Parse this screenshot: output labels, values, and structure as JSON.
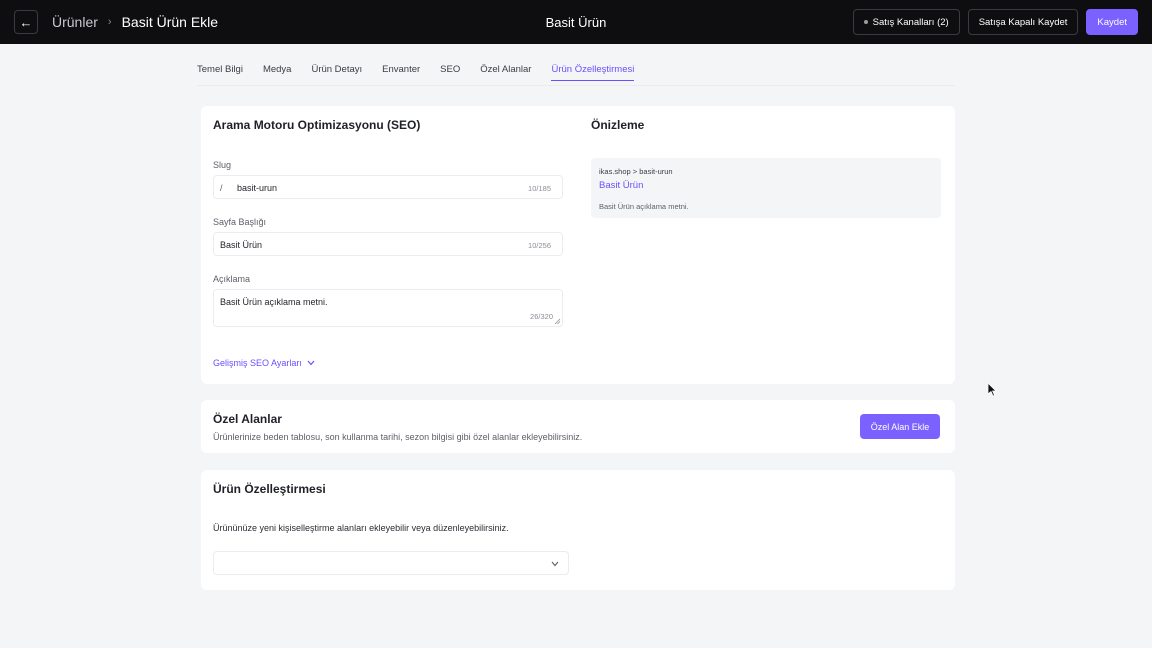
{
  "header": {
    "back_icon": "arrow-left-icon",
    "breadcrumb_parent": "Ürünler",
    "breadcrumb_separator": "›",
    "breadcrumb_current": "Basit Ürün Ekle",
    "center_title": "Basit Ürün",
    "sales_channels_label": "Satış Kanalları (2)",
    "save_closed_label": "Satışa Kapalı Kaydet",
    "save_label": "Kaydet",
    "primary_color": "#7b61ff"
  },
  "tabs": [
    {
      "label": "Temel Bilgi"
    },
    {
      "label": "Medya"
    },
    {
      "label": "Ürün Detayı"
    },
    {
      "label": "Envanter"
    },
    {
      "label": "SEO"
    },
    {
      "label": "Özel Alanlar"
    },
    {
      "label": "Ürün Özelleştirmesi",
      "active": true
    }
  ],
  "seo": {
    "title": "Arama Motoru Optimizasyonu (SEO)",
    "slug_label": "Slug",
    "slug_prefix": "/",
    "slug_value": "basit-urun",
    "slug_count": "10/185",
    "page_title_label": "Sayfa Başlığı",
    "page_title_value": "Basit Ürün",
    "page_title_count": "10/256",
    "description_label": "Açıklama",
    "description_value": "Basit Ürün açıklama metni.",
    "description_count": "26/320",
    "advanced_link": "Gelişmiş SEO Ayarları"
  },
  "preview": {
    "title": "Önizleme",
    "url": "ikas.shop > basit-urun",
    "page_title": "Basit Ürün",
    "description": "Basit Ürün açıklama metni."
  },
  "custom_fields": {
    "title": "Özel Alanlar",
    "subtitle": "Ürünlerinize beden tablosu, son kullanma tarihi, sezon bilgisi gibi özel alanlar ekleyebilirsiniz.",
    "add_button": "Özel Alan Ekle"
  },
  "customization": {
    "title": "Ürün Özelleştirmesi",
    "subtitle": "Ürününüze yeni kişiselleştirme alanları ekleyebilir veya düzenleyebilirsiniz.",
    "select_value": ""
  }
}
